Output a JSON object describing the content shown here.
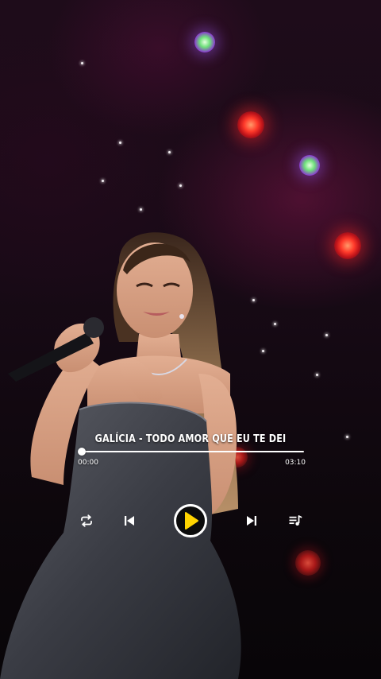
{
  "player": {
    "song_title": "GALÍCIA - TODO AMOR QUE EU TE DEI",
    "elapsed_time": "00:00",
    "total_time": "03:10",
    "progress_fraction": 0.0,
    "accent_color": "#ffd400",
    "controls": {
      "repeat": "repeat-icon",
      "previous": "skip-previous-icon",
      "play": "play-icon",
      "next": "skip-next-icon",
      "playlist": "playlist-icon"
    }
  }
}
